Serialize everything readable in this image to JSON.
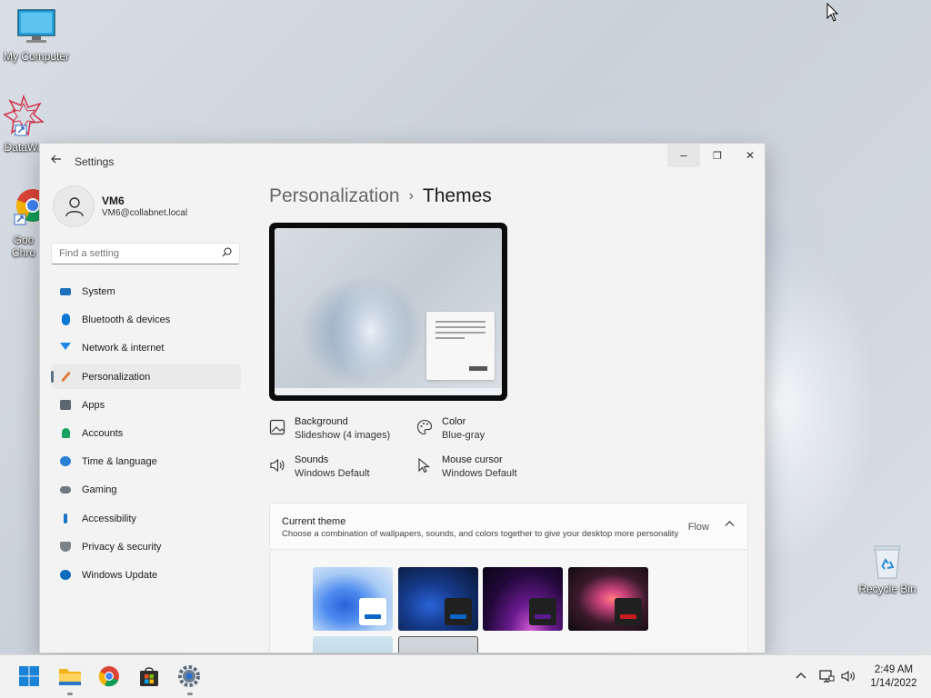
{
  "desktop": {
    "icons": [
      {
        "name": "my-computer",
        "label": "My Computer"
      },
      {
        "name": "datawave",
        "label": "DataWa"
      },
      {
        "name": "google-chrome",
        "label": "Goo Chro"
      }
    ],
    "recycle_bin_label": "Recycle Bin"
  },
  "window": {
    "title": "Settings",
    "buttons": {
      "minimize": "–",
      "maximize": "❐",
      "close": "✕"
    }
  },
  "user": {
    "name": "VM6",
    "email": "VM6@collabnet.local"
  },
  "search": {
    "placeholder": "Find a setting"
  },
  "nav": {
    "items": [
      {
        "label": "System",
        "icon": "monitor-icon",
        "color": "#1f6fbf"
      },
      {
        "label": "Bluetooth & devices",
        "icon": "bluetooth-icon",
        "color": "#0a78d4"
      },
      {
        "label": "Network & internet",
        "icon": "wifi-icon",
        "color": "#1e88e5"
      },
      {
        "label": "Personalization",
        "icon": "brush-icon",
        "color": "#e07b39",
        "active": true
      },
      {
        "label": "Apps",
        "icon": "apps-icon",
        "color": "#5c6670"
      },
      {
        "label": "Accounts",
        "icon": "person-icon",
        "color": "#1aa260"
      },
      {
        "label": "Time & language",
        "icon": "globe-clock-icon",
        "color": "#2a7fd4"
      },
      {
        "label": "Gaming",
        "icon": "controller-icon",
        "color": "#6f7780"
      },
      {
        "label": "Accessibility",
        "icon": "accessibility-icon",
        "color": "#1a73c7"
      },
      {
        "label": "Privacy & security",
        "icon": "shield-icon",
        "color": "#7a828a"
      },
      {
        "label": "Windows Update",
        "icon": "update-icon",
        "color": "#0f6cbd"
      }
    ]
  },
  "main": {
    "breadcrumb_parent": "Personalization",
    "breadcrumb_separator": "›",
    "breadcrumb_current": "Themes",
    "attributes": [
      {
        "name": "Background",
        "value": "Slideshow (4 images)",
        "icon": "picture-icon"
      },
      {
        "name": "Color",
        "value": "Blue-gray",
        "icon": "palette-icon"
      },
      {
        "name": "Sounds",
        "value": "Windows Default",
        "icon": "speaker-icon"
      },
      {
        "name": "Mouse cursor",
        "value": "Windows Default",
        "icon": "cursor-icon"
      }
    ],
    "current_theme": {
      "title": "Current theme",
      "description": "Choose a combination of wallpapers, sounds, and colors together to give your desktop more personality",
      "value": "Flow",
      "expanded_glyph": "˄"
    },
    "theme_tiles": [
      {
        "name": "windows-light",
        "accent": "#0a66c8",
        "swatch_bg": "#ffffff"
      },
      {
        "name": "windows-dark",
        "accent": "#0a66c8",
        "swatch_bg": "#202020"
      },
      {
        "name": "glow",
        "accent": "#5b1a8e",
        "swatch_bg": "#202020"
      },
      {
        "name": "captured-motion",
        "accent": "#c81c1c",
        "swatch_bg": "#202020"
      },
      {
        "name": "sunrise",
        "accent": "",
        "swatch_bg": ""
      },
      {
        "name": "flow",
        "accent": "",
        "swatch_bg": ""
      }
    ]
  },
  "taskbar": {
    "apps": [
      {
        "name": "start-button"
      },
      {
        "name": "file-explorer"
      },
      {
        "name": "chrome"
      },
      {
        "name": "microsoft-store"
      },
      {
        "name": "settings"
      }
    ],
    "time": "2:49 AM",
    "date": "1/14/2022"
  },
  "colors": {
    "accent": "#5a7187",
    "window_bg": "#f3f3f3"
  }
}
